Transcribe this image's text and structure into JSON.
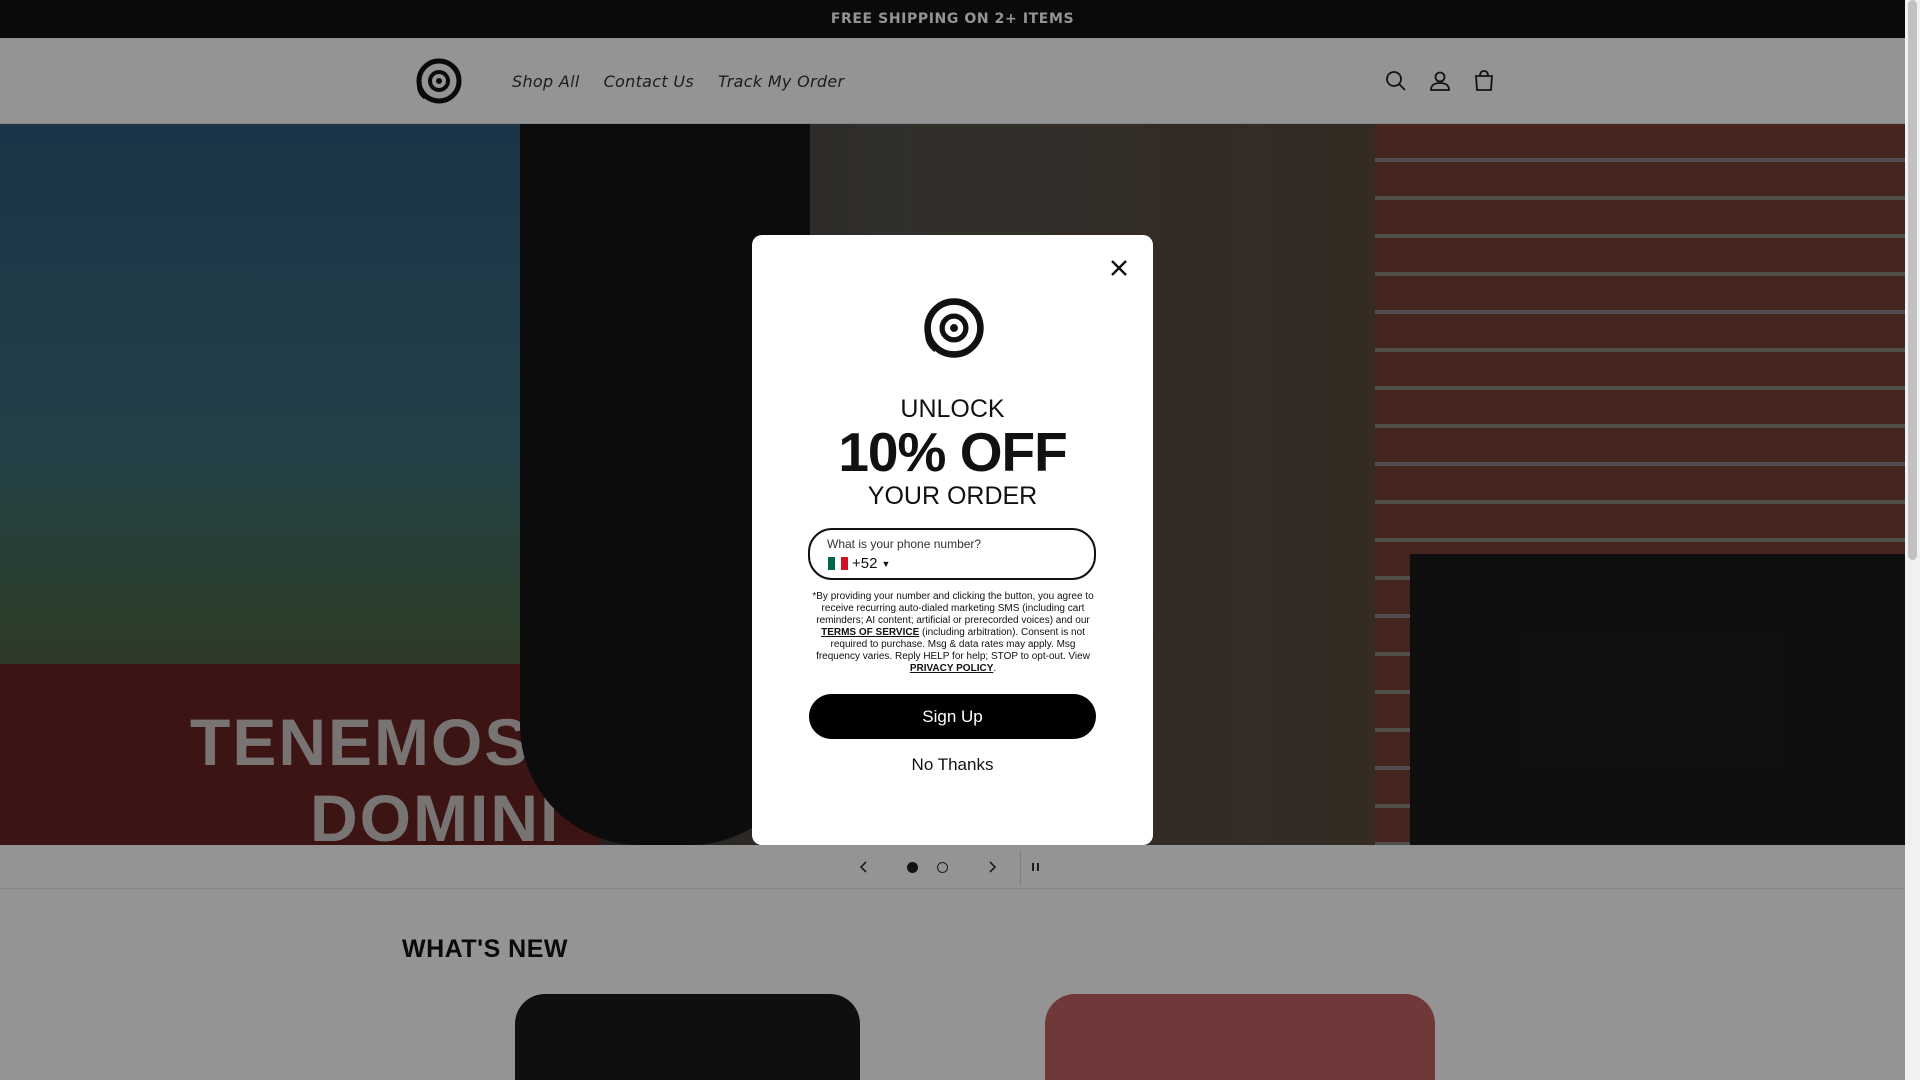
{
  "announcement": {
    "text": "FREE SHIPPING ON 2+ ITEMS"
  },
  "header": {
    "nav": [
      {
        "label": "Shop All"
      },
      {
        "label": "Contact Us"
      },
      {
        "label": "Track My Order"
      }
    ],
    "icons": [
      "search-icon",
      "account-icon",
      "cart-icon"
    ]
  },
  "hero": {
    "sign_text": "TENEMOS P",
    "sign_text_2": "DOMINI",
    "slide_count": 2,
    "active_slide": 1
  },
  "section": {
    "title": "WHAT'S NEW"
  },
  "modal": {
    "unlock": "UNLOCK",
    "percent": "10% OFF",
    "your_order": "YOUR ORDER",
    "phone_label": "What is your phone number?",
    "country_code": "+52",
    "disclaimer_part1": "*By providing your number and clicking the button, you agree to receive recurring auto-dialed marketing SMS (including cart reminders; AI content; artificial or prerecorded voices) and our ",
    "terms_link": "TERMS OF SERVICE",
    "disclaimer_part2": " (including arbitration). Consent is not required to purchase. Msg & data rates may apply. Msg frequency varies. Reply HELP for help; STOP to opt-out. View ",
    "privacy_link": "PRIVACY POLICY",
    "disclaimer_end": ".",
    "signup_label": "Sign Up",
    "nothanks_label": "No Thanks"
  },
  "colors": {
    "announcement_bg": "#121212",
    "button_bg": "#000000",
    "overlay": "rgba(0,0,0,0.42)"
  }
}
